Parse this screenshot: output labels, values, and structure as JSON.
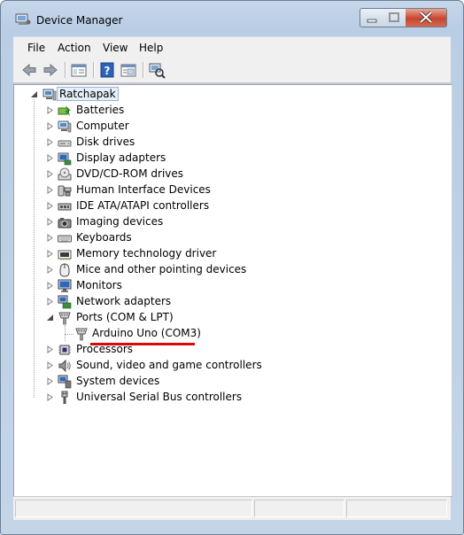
{
  "window": {
    "title": "Device Manager"
  },
  "menu": [
    {
      "label": "File"
    },
    {
      "label": "Action"
    },
    {
      "label": "View"
    },
    {
      "label": "Help"
    }
  ],
  "toolbar": {
    "buttons": [
      "back-icon",
      "forward-icon",
      "show-hide-console-tree-icon",
      "help-icon",
      "properties-icon",
      "scan-hardware-icon"
    ]
  },
  "tree": {
    "root": {
      "label": "Ratchapak",
      "icon": "computer-icon",
      "expanded": true
    },
    "categories": [
      {
        "label": "Batteries",
        "icon": "battery-icon"
      },
      {
        "label": "Computer",
        "icon": "computer-icon"
      },
      {
        "label": "Disk drives",
        "icon": "disk-drive-icon"
      },
      {
        "label": "Display adapters",
        "icon": "display-adapter-icon"
      },
      {
        "label": "DVD/CD-ROM drives",
        "icon": "dvd-drive-icon"
      },
      {
        "label": "Human Interface Devices",
        "icon": "hid-icon"
      },
      {
        "label": "IDE ATA/ATAPI controllers",
        "icon": "ide-controller-icon"
      },
      {
        "label": "Imaging devices",
        "icon": "camera-icon"
      },
      {
        "label": "Keyboards",
        "icon": "keyboard-icon"
      },
      {
        "label": "Memory technology driver",
        "icon": "memory-icon"
      },
      {
        "label": "Mice and other pointing devices",
        "icon": "mouse-icon"
      },
      {
        "label": "Monitors",
        "icon": "monitor-icon"
      },
      {
        "label": "Network adapters",
        "icon": "network-icon"
      },
      {
        "label": "Ports (COM & LPT)",
        "icon": "port-icon",
        "expanded": true,
        "children": [
          {
            "label": "Arduino Uno (COM3)",
            "icon": "port-icon",
            "highlighted": true
          }
        ]
      },
      {
        "label": "Processors",
        "icon": "processor-icon"
      },
      {
        "label": "Sound, video and game controllers",
        "icon": "speaker-icon"
      },
      {
        "label": "System devices",
        "icon": "system-device-icon"
      },
      {
        "label": "Universal Serial Bus controllers",
        "icon": "usb-icon"
      }
    ]
  },
  "colors": {
    "annotation_underline": "#d90a0a",
    "selection_border": "#99b4d8"
  },
  "statusbar": {
    "text": ""
  }
}
